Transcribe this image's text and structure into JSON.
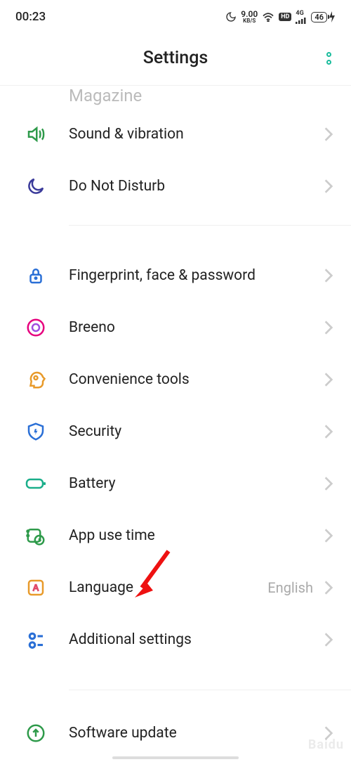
{
  "status": {
    "time": "00:23",
    "net_speed": "9.00",
    "net_unit": "KB/S",
    "hd": "HD",
    "net_type": "4G",
    "battery": "46"
  },
  "header": {
    "title": "Settings"
  },
  "partial_row_label": "Magazine",
  "rows": {
    "sound": "Sound & vibration",
    "dnd": "Do Not Disturb",
    "fingerprint": "Fingerprint, face & password",
    "breeno": "Breeno",
    "convenience": "Convenience tools",
    "security": "Security",
    "battery": "Battery",
    "apptime": "App use time",
    "language": "Language",
    "language_value": "English",
    "additional": "Additional settings",
    "software": "Software update"
  }
}
